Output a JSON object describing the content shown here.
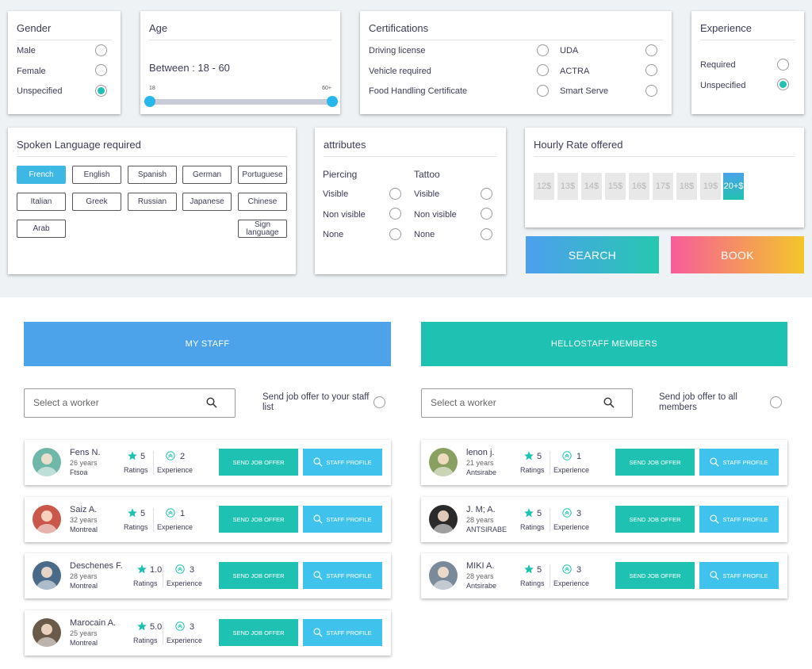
{
  "filters": {
    "gender": {
      "title": "Gender",
      "options": [
        {
          "label": "Male",
          "checked": false
        },
        {
          "label": "Female",
          "checked": false
        },
        {
          "label": "Unspecified",
          "checked": true
        }
      ]
    },
    "age": {
      "title": "Age",
      "range_text": "Between : 18 - 60",
      "min_label": "18",
      "max_label": "60+"
    },
    "certifications": {
      "title": "Certifications",
      "options": [
        {
          "label": "Driving license",
          "checked": false
        },
        {
          "label": "Vehicle required",
          "checked": false
        },
        {
          "label": "Food Handling Certificate",
          "checked": false
        },
        {
          "label": "UDA",
          "checked": false
        },
        {
          "label": "ACTRA",
          "checked": false
        },
        {
          "label": "Smart Serve",
          "checked": false
        }
      ]
    },
    "experience": {
      "title": "Experience",
      "options": [
        {
          "label": "Required",
          "checked": false
        },
        {
          "label": "Unspecified",
          "checked": true
        }
      ]
    },
    "languages": {
      "title": "Spoken Language required",
      "items": [
        {
          "label": "French",
          "active": true
        },
        {
          "label": "English",
          "active": false
        },
        {
          "label": "Spanish",
          "active": false
        },
        {
          "label": "German",
          "active": false
        },
        {
          "label": "Portuguese",
          "active": false
        },
        {
          "label": "Italian",
          "active": false
        },
        {
          "label": "Greek",
          "active": false
        },
        {
          "label": "Russian",
          "active": false
        },
        {
          "label": "Japanese",
          "active": false
        },
        {
          "label": "Chinese",
          "active": false
        },
        {
          "label": "Arab",
          "active": false
        },
        {
          "label": "Sign language",
          "active": false
        }
      ]
    },
    "attributes": {
      "title": "attributes",
      "piercing": {
        "title": "Piercing",
        "options": [
          {
            "label": "Visible",
            "checked": false
          },
          {
            "label": "Non visible",
            "checked": false
          },
          {
            "label": "None",
            "checked": false
          }
        ]
      },
      "tattoo": {
        "title": "Tattoo",
        "options": [
          {
            "label": "Visible",
            "checked": false
          },
          {
            "label": "Non visible",
            "checked": false
          },
          {
            "label": "None",
            "checked": false
          }
        ]
      }
    },
    "hourly_rate": {
      "title": "Hourly Rate offered",
      "rates": [
        {
          "label": "12$",
          "active": false
        },
        {
          "label": "13$",
          "active": false
        },
        {
          "label": "14$",
          "active": false
        },
        {
          "label": "15$",
          "active": false
        },
        {
          "label": "16$",
          "active": false
        },
        {
          "label": "17$",
          "active": false
        },
        {
          "label": "18$",
          "active": false
        },
        {
          "label": "19$",
          "active": false
        },
        {
          "label": "20+$",
          "active": true
        }
      ]
    }
  },
  "actions": {
    "search_label": "SEARCH",
    "book_label": "BOOK"
  },
  "my_staff": {
    "tab_label": "MY STAFF",
    "search_placeholder": "Select a worker",
    "offer_text": "Send job offer to your staff list",
    "workers": [
      {
        "name": "Fens N.",
        "age": "26 years",
        "city": "Ftsoa",
        "rating": "5",
        "experience": "2"
      },
      {
        "name": "Saiz A.",
        "age": "32 years",
        "city": "Montreal",
        "rating": "5",
        "experience": "1"
      },
      {
        "name": "Deschenes F.",
        "age": "28 years",
        "city": "Montreal",
        "rating": "1.0",
        "experience": "3"
      },
      {
        "name": "Marocain A.",
        "age": "25 years",
        "city": "Montreal",
        "rating": "5.0",
        "experience": "3"
      }
    ]
  },
  "members": {
    "tab_label": "HELLOSTAFF MEMBERS",
    "search_placeholder": "Select a worker",
    "offer_text": "Send job offer to all members",
    "workers": [
      {
        "name": "lenon j.",
        "age": "21 years",
        "city": "Antsirabe",
        "rating": "5",
        "experience": "1"
      },
      {
        "name": "J. M; A.",
        "age": "28 years",
        "city": "ANTSIRABE",
        "rating": "5",
        "experience": "3"
      },
      {
        "name": "MIKI A.",
        "age": "28 years",
        "city": "Antsirabe",
        "rating": "5",
        "experience": "3"
      }
    ]
  },
  "labels": {
    "ratings": "Ratings",
    "experience": "Experience",
    "send_job_offer": "SEND JOB OFFER",
    "staff_profile": "STAFF PROFILE"
  },
  "colors": {
    "teal": "#1fc2b2",
    "blue": "#4da3ea",
    "light_blue": "#3fc3ec",
    "active_lang": "#3db7e4"
  },
  "avatar_colors": [
    "#6fb7a8",
    "#c9584a",
    "#4a6a8a",
    "#6a5a4a",
    "#8aa060",
    "#2a2a2a",
    "#7a8a9a"
  ],
  "avatar_photos": [
    "avatar-fens-photo",
    "avatar-saiz-photo",
    "avatar-deschenes-photo",
    "avatar-marocain-photo",
    "avatar-lenon-photo",
    "avatar-jma-photo",
    "avatar-miki-photo"
  ]
}
